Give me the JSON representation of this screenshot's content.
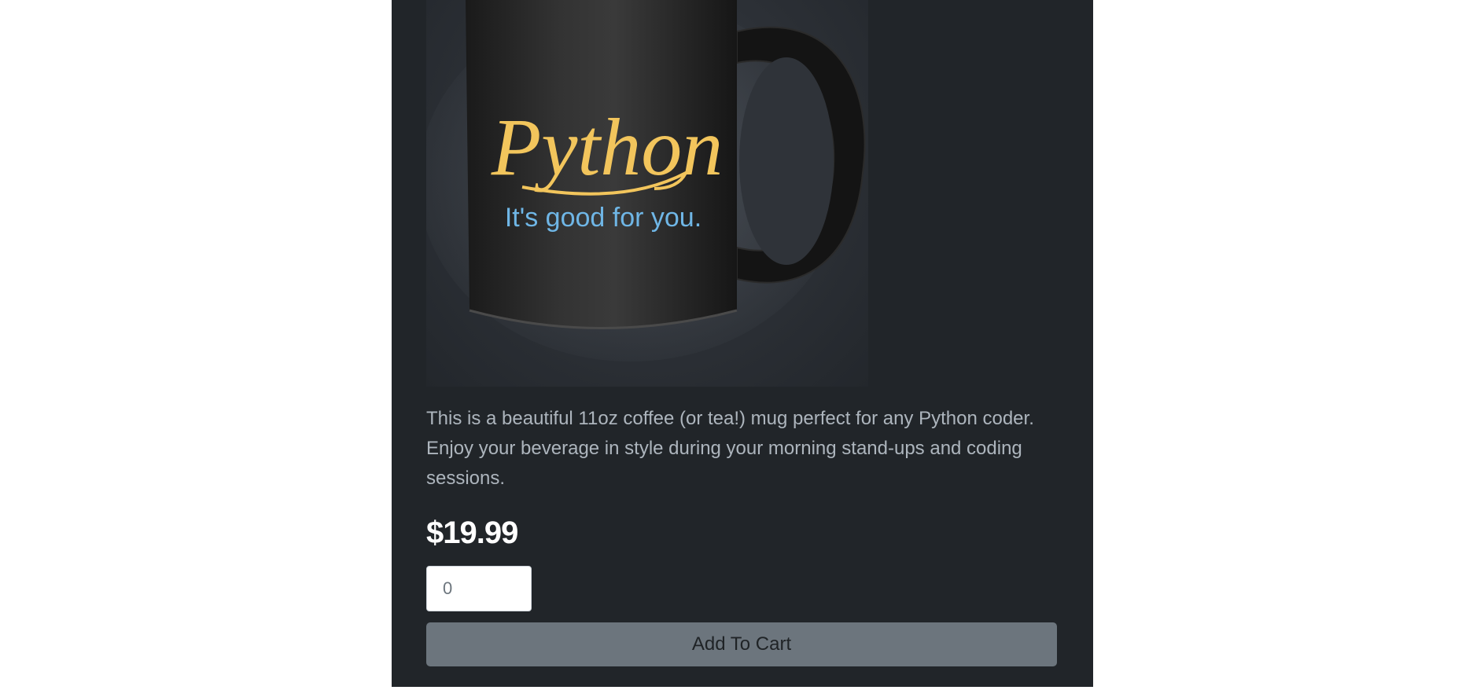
{
  "product": {
    "image": {
      "mug_color": "#1b1b1b",
      "title_text": "Python",
      "tagline_text": "It's good for you.",
      "title_color": "#f2c55c",
      "tagline_color": "#6fb6e6"
    },
    "description": "This is a beautiful 11oz coffee (or tea!) mug perfect for any Python coder. Enjoy your beverage in style during your morning stand-ups and coding sessions.",
    "price": "$19.99",
    "quantity": {
      "value": "0"
    },
    "add_to_cart_label": "Add To Cart"
  },
  "colors": {
    "card_background": "#212529",
    "button_background": "#6c757d",
    "description_text": "#adb5bd",
    "price_text": "#ffffff"
  }
}
